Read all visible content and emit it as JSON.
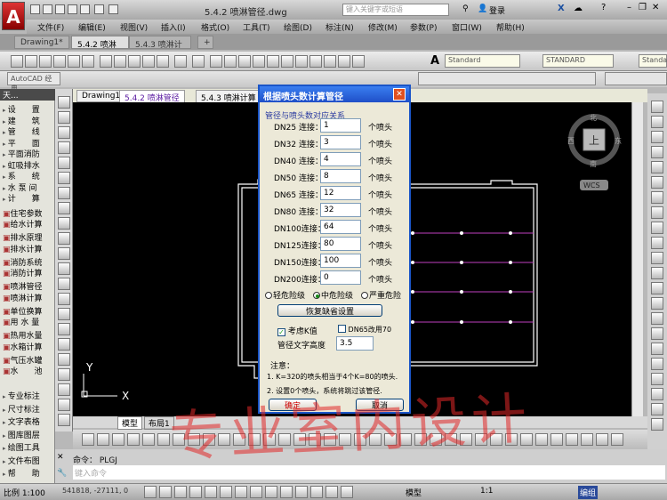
{
  "app": {
    "title": "5.4.2  喷淋管径.dwg",
    "search_placeholder": "键入关键字或短语",
    "login": "登录",
    "logo": "A"
  },
  "menu": [
    "文件(F)",
    "编辑(E)",
    "视图(V)",
    "插入(I)",
    "格式(O)",
    "工具(T)",
    "绘图(D)",
    "标注(N)",
    "修改(M)",
    "参数(P)",
    "窗口(W)",
    "帮助(H)"
  ],
  "file_tabs": [
    "Drawing1*",
    "5.4.2  喷淋管径*",
    "5.4.3  喷淋计算*"
  ],
  "toolbar": {
    "text_style": "Standard",
    "dim_style": "STANDARD",
    "style3": "Standa",
    "workspace": "AutoCAD 经典"
  },
  "left_panel": {
    "header": "天...",
    "groups": [
      "设　　置",
      "建　　筑",
      "管　　线",
      "平　　面",
      "平面消防",
      "虹吸排水",
      "系　　统",
      "水 泵 间",
      "计　　算"
    ],
    "items": [
      "住宅参数",
      "给水计算",
      "排水原理",
      "排水计算",
      "消防系统",
      "消防计算",
      "喷淋管径",
      "喷淋计算",
      "单位换算",
      "用 水 量",
      "热用水量",
      "水箱计算",
      "气压水罐",
      "水　　池"
    ],
    "groups2": [
      "专业标注",
      "尺寸标注",
      "文字表格",
      "图库图层",
      "绘图工具",
      "文件布图",
      "帮　　助"
    ]
  },
  "drawing_tabs": [
    "Drawing1",
    "5.4.2  喷淋管径",
    "5.4.3  喷淋计算"
  ],
  "viewcube": {
    "top": "北",
    "bottom": "南",
    "left": "西",
    "right": "东",
    "face": "上",
    "wcs": "WCS"
  },
  "ucs": {
    "y": "Y",
    "x": "X"
  },
  "layout_tabs": [
    "模型",
    "布局1"
  ],
  "dialog": {
    "title": "根据喷头数计算管径",
    "group": "管径与喷头数对应关系",
    "rows": [
      {
        "label": "DN25 连接：",
        "value": "1",
        "unit": "个喷头"
      },
      {
        "label": "DN32 连接：",
        "value": "3",
        "unit": "个喷头"
      },
      {
        "label": "DN40 连接：",
        "value": "4",
        "unit": "个喷头"
      },
      {
        "label": "DN50 连接：",
        "value": "8",
        "unit": "个喷头"
      },
      {
        "label": "DN65 连接：",
        "value": "12",
        "unit": "个喷头"
      },
      {
        "label": "DN80 连接：",
        "value": "32",
        "unit": "个喷头"
      },
      {
        "label": "DN100连接：",
        "value": "64",
        "unit": "个喷头"
      },
      {
        "label": "DN125连接：",
        "value": "80",
        "unit": "个喷头"
      },
      {
        "label": "DN150连接：",
        "value": "100",
        "unit": "个喷头"
      },
      {
        "label": "DN200连接：",
        "value": "0",
        "unit": "个喷头"
      }
    ],
    "hazard": {
      "options": [
        "轻危险级",
        "中危险级",
        "严重危险"
      ],
      "selected": "中危险级"
    },
    "restore": "恢复缺省设置",
    "consider_k": {
      "label": "考虑K值",
      "checked": true
    },
    "dn65": {
      "label": "DN65改用70",
      "checked": false
    },
    "text_height_label": "管径文字高度",
    "text_height": "3.5",
    "note_title": "注意：",
    "note1": "1. K=320的喷头相当于4个K=80的喷头.",
    "note2": "2. 设置0个喷头，系统将跳过该管径.",
    "ok": "确定",
    "cancel": "取消"
  },
  "command": {
    "history": "命令： PLGJ",
    "placeholder": "键入命令"
  },
  "status": {
    "scale": "比例 1:100",
    "coords": "541818,  -27111,  0",
    "model": "模型",
    "anno_scale": "1:1",
    "layer_btn": "编组"
  },
  "watermark": "专业室内设计",
  "colors": {
    "canvas": "#000000",
    "pipe": "#c040c0",
    "dialog_title": "#1f4fc8",
    "watermark": "#e02828"
  }
}
